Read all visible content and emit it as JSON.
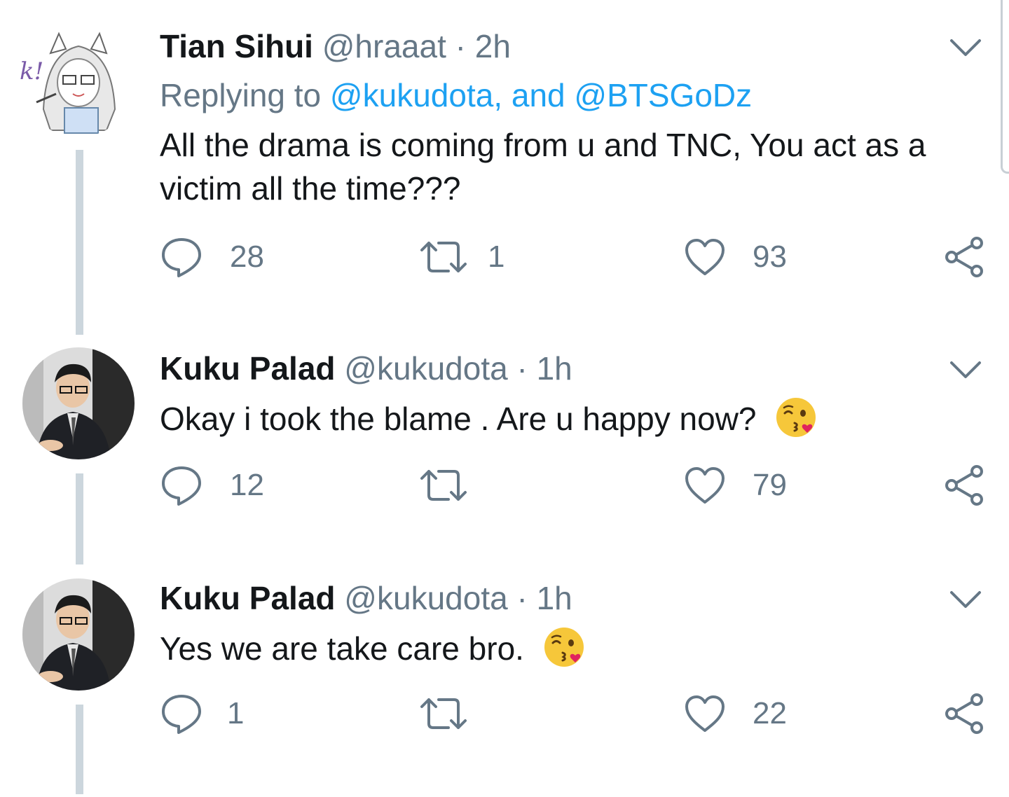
{
  "tweets": [
    {
      "name": "Tian Sihui",
      "handle": "@hraaat",
      "separator": "·",
      "time": "2h",
      "replying_prefix": "Replying to",
      "replying_mentions": "@kukudota, and @BTSGoDz",
      "text_line1": "All the drama is coming from u and TNC, You  act as a",
      "text_line2": "victim all the time???",
      "avatar_text": "k!",
      "reply_count": "28",
      "retweet_count": "1",
      "like_count": "93"
    },
    {
      "name": "Kuku Palad",
      "handle": "@kukudota",
      "separator": "·",
      "time": "1h",
      "text": "Okay i took the blame . Are u happy now?",
      "reply_count": "12",
      "retweet_count": "",
      "like_count": "79"
    },
    {
      "name": "Kuku Palad",
      "handle": "@kukudota",
      "separator": "·",
      "time": "1h",
      "text": "Yes we are take care bro.",
      "reply_count": "1",
      "retweet_count": "",
      "like_count": "22"
    }
  ],
  "icons": {
    "reply": "reply-icon",
    "retweet": "retweet-icon",
    "like": "heart-icon",
    "share": "share-icon",
    "more": "chevron-down-icon",
    "emoji": "kissing-face-emoji"
  },
  "colors": {
    "text": "#14171a",
    "secondary": "#657786",
    "link": "#1da1f2",
    "thread": "#ccd6dd"
  }
}
